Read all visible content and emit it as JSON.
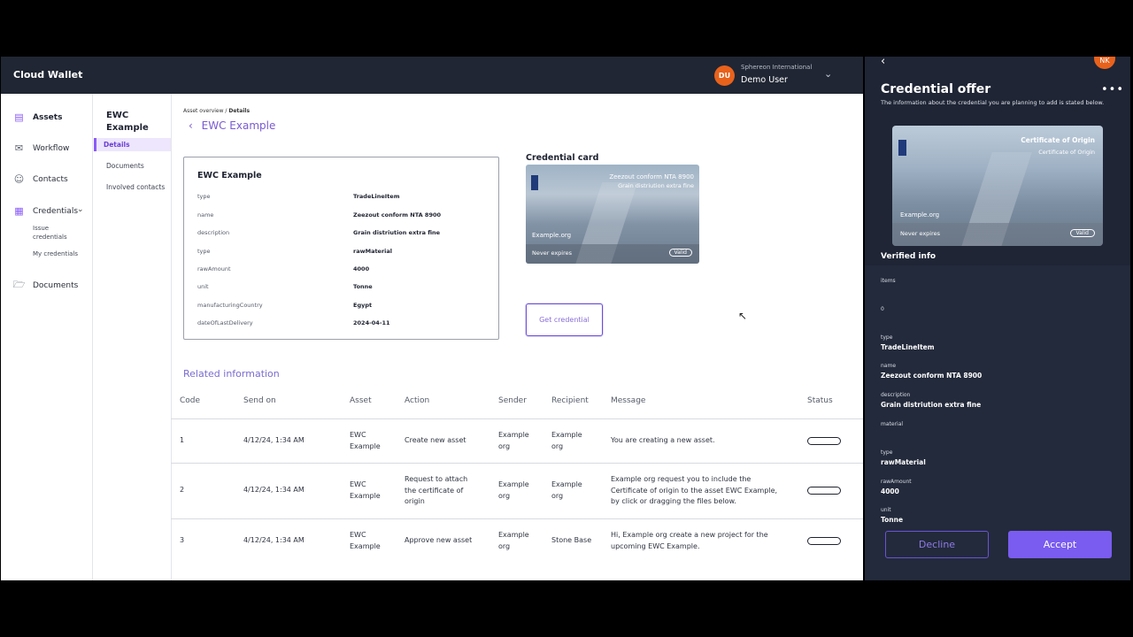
{
  "app": {
    "brand": "Cloud Wallet"
  },
  "user": {
    "initials": "DU",
    "org": "Sphereon International",
    "name": "Demo User"
  },
  "sidebar": {
    "assets": "Assets",
    "workflow": "Workflow",
    "contacts": "Contacts",
    "credentials": "Credentials",
    "issue_credentials_1": "Issue",
    "issue_credentials_2": "credentials",
    "my_credentials": "My credentials",
    "documents": "Documents"
  },
  "subnav": {
    "title": "EWC Example",
    "details": "Details",
    "documents": "Documents",
    "involved_contacts": "Involved contacts"
  },
  "breadcrumb": {
    "parent": "Asset overview",
    "sep": " / ",
    "current": "Details"
  },
  "back_title": "EWC Example",
  "detail_card": {
    "title": "EWC Example",
    "rows": [
      {
        "key": "type",
        "value": "TradeLineItem"
      },
      {
        "key": "name",
        "value": "Zeezout conform NTA 8900"
      },
      {
        "key": "description",
        "value": "Grain distriution extra fine"
      },
      {
        "key": "type",
        "value": "rawMaterial"
      },
      {
        "key": "rawAmount",
        "value": "4000"
      },
      {
        "key": "unit",
        "value": "Tonne"
      },
      {
        "key": "manufacturingCountry",
        "value": "Egypt"
      },
      {
        "key": "dateOfLastDelivery",
        "value": "2024-04-11"
      }
    ]
  },
  "credential_card": {
    "label": "Credential card",
    "line1": "Zeezout conform NTA 8900",
    "line2": "Grain distriution extra fine",
    "issuer": "Example.org",
    "expiry": "Never expires",
    "status": "Valid"
  },
  "get_credential": "Get credential",
  "related": {
    "title": "Related information",
    "headers": [
      "Code",
      "Send on",
      "Asset",
      "Action",
      "Sender",
      "Recipient",
      "Message",
      "Status"
    ],
    "rows": [
      {
        "code": "1",
        "send_on": "4/12/24, 1:34 AM",
        "asset": [
          "EWC",
          "Example"
        ],
        "action": [
          "Create new asset"
        ],
        "sender": [
          "Example",
          "org"
        ],
        "recipient": [
          "Example",
          "org"
        ],
        "message": [
          "You are creating a new asset."
        ]
      },
      {
        "code": "2",
        "send_on": "4/12/24, 1:34 AM",
        "asset": [
          "EWC",
          "Example"
        ],
        "action": [
          "Request to attach",
          "the certificate of",
          "origin"
        ],
        "sender": [
          "Example",
          "org"
        ],
        "recipient": [
          "Example",
          "org"
        ],
        "message": [
          "Example org request you to include the",
          "Certificate of origin to the asset EWC Example,",
          "by click or dragging the files below."
        ]
      },
      {
        "code": "3",
        "send_on": "4/12/24, 1:34 AM",
        "asset": [
          "EWC",
          "Example"
        ],
        "action": [
          "Approve new asset"
        ],
        "sender": [
          "Example",
          "org"
        ],
        "recipient": [
          "Stone Base"
        ],
        "message": [
          "Hi, Example org create a new project for the",
          "upcoming EWC Example."
        ]
      }
    ]
  },
  "panel": {
    "avatar": "NK",
    "title": "Credential offer",
    "description": "The information about the credential you are planning to add is stated below.",
    "card": {
      "line1": "Certificate of Origin",
      "line2": "Certificate of Origin",
      "issuer": "Example.org",
      "expiry": "Never expires",
      "status": "Valid"
    },
    "verified_title": "Verified info",
    "fields": [
      {
        "key": "items",
        "value": ""
      },
      {
        "key": "0",
        "value": ""
      },
      {
        "key": "type",
        "value": "TradeLineItem"
      },
      {
        "key": "name",
        "value": "Zeezout conform NTA 8900"
      },
      {
        "key": "description",
        "value": "Grain distriution extra fine"
      },
      {
        "key": "material",
        "value": ""
      },
      {
        "key": "type",
        "value": "rawMaterial"
      },
      {
        "key": "rawAmount",
        "value": "4000"
      },
      {
        "key": "unit",
        "value": "Tonne"
      }
    ],
    "decline": "Decline",
    "accept": "Accept"
  },
  "colors": {
    "accent": "#7a5cf0",
    "topbar": "#202633",
    "panel": "#232a3b",
    "avatar": "#e8621c"
  },
  "icons": [
    "assets-icon",
    "workflow-icon",
    "contacts-icon",
    "credentials-icon",
    "documents-icon",
    "back-chevron-icon",
    "more-icon",
    "chevron-down-icon"
  ]
}
